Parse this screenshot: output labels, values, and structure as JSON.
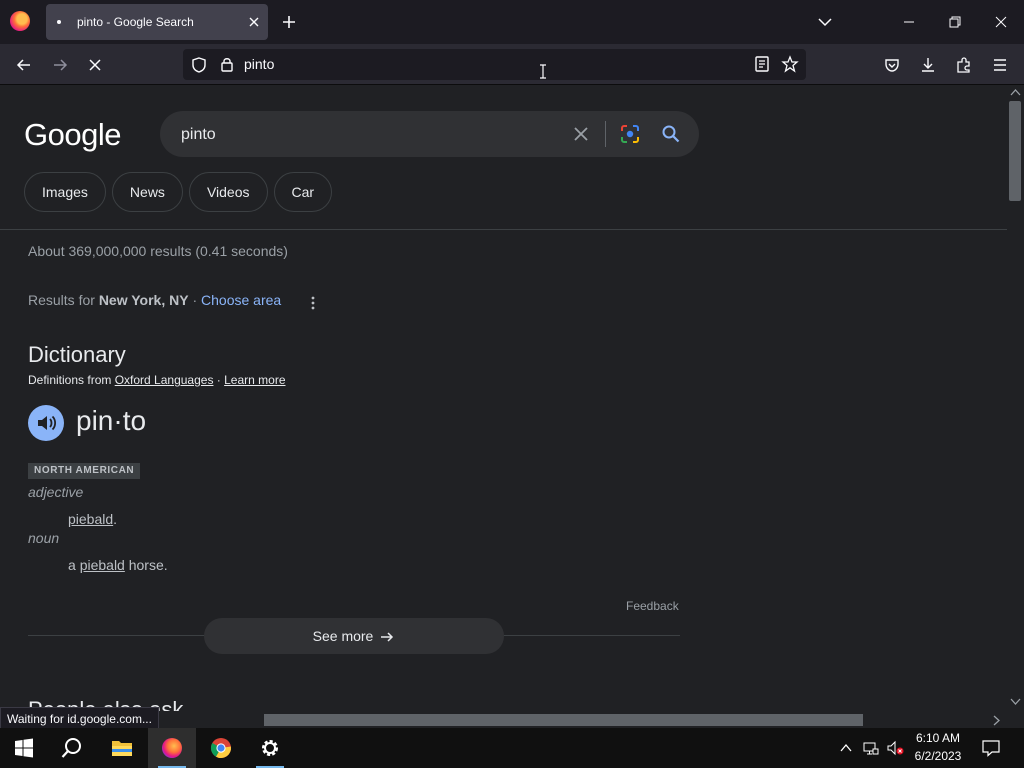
{
  "browser": {
    "tab": {
      "title": "pinto - Google Search"
    },
    "url": "pinto"
  },
  "google": {
    "logo": "Google",
    "query": "pinto",
    "chips": [
      "Images",
      "News",
      "Videos",
      "Car"
    ],
    "result_stats": "About 369,000,000 results (0.41 seconds)",
    "location": {
      "prefix": "Results for ",
      "place": "New York, NY",
      "separator": " · ",
      "choose": "Choose area"
    }
  },
  "dictionary": {
    "title": "Dictionary",
    "source_prefix": "Definitions from ",
    "source_link": "Oxford Languages",
    "source_sep": " · ",
    "learn_more": "Learn more",
    "word": "pin·to",
    "region": "NORTH AMERICAN",
    "senses": [
      {
        "pos": "adjective",
        "def_prefix": "",
        "def_link": "piebald",
        "def_suffix": "."
      },
      {
        "pos": "noun",
        "def_prefix": "a ",
        "def_link": "piebald",
        "def_suffix": " horse."
      }
    ],
    "feedback": "Feedback",
    "see_more": "See more",
    "next_heading": "People also ask"
  },
  "status_text": "Waiting for id.google.com...",
  "taskbar": {
    "time": "6:10 AM",
    "date": "6/2/2023"
  },
  "icons": {
    "browser_logo": "firefox-icon",
    "tab_close": "close-icon",
    "new_tab": "plus-icon",
    "tab_list": "chevron-down-icon",
    "minimize": "minimize-icon",
    "restore": "restore-icon",
    "close_window": "close-icon",
    "back": "back-arrow-icon",
    "forward": "forward-arrow-icon",
    "stop": "stop-icon",
    "tracking": "shield-icon",
    "lock": "lock-icon",
    "reader": "reader-view-icon",
    "bookmark": "star-icon",
    "pocket": "pocket-icon",
    "downloads": "download-icon",
    "extensions": "puzzle-icon",
    "menu": "hamburger-menu-icon",
    "clear": "close-icon",
    "lens": "google-lens-icon",
    "search": "search-icon",
    "more": "more-vertical-icon",
    "speaker": "speaker-icon",
    "see_more": "arrow-right-icon",
    "start": "windows-start-icon",
    "taskbar_search": "search-icon",
    "explorer": "file-explorer-icon",
    "firefox": "firefox-icon",
    "chrome": "chrome-icon",
    "settings": "gear-icon",
    "tray": "chevron-up-icon",
    "network": "network-icon",
    "volume": "volume-muted-icon",
    "notifications": "notification-icon"
  },
  "colors": {
    "page_bg": "#202124",
    "link": "#8ab4f8",
    "toolbar": "#2b2a33",
    "taskbar": "#101010"
  }
}
